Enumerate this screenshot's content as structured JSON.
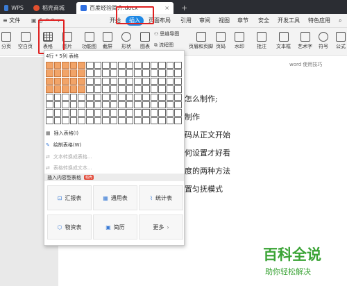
{
  "tabs": {
    "wps": "WPS",
    "store": "稻壳商城",
    "doc": "百度经验简介.docx",
    "add": "+"
  },
  "menubar": {
    "file": "≡ 文件",
    "items": [
      "开始",
      "插入",
      "页面布局",
      "引用",
      "审阅",
      "视图",
      "章节",
      "安全",
      "开发工具",
      "特色应用"
    ],
    "active": "插入"
  },
  "ribbon": {
    "left": [
      "分页",
      "空白页"
    ],
    "table": "表格",
    "picture": "图片",
    "shapes": [
      "功能图",
      "截屏",
      "形状",
      "图表"
    ],
    "mind": [
      "思维导图",
      "流程图"
    ],
    "right": [
      "页眉和页脚",
      "页码",
      "水印",
      "批注",
      "文本框",
      "艺术字",
      "符号",
      "公式"
    ]
  },
  "dropdown": {
    "grid_label": "4行 * 5列 表格",
    "rows": 8,
    "cols": 17,
    "sel_rows": 4,
    "sel_cols": 5,
    "menu": [
      "插入表格(I)",
      "绘制表格(W)",
      "文本转换成表格...",
      "表格转换成文本..."
    ],
    "section": "插入内容型表格",
    "badge": "稻壳",
    "cards": [
      "汇报表",
      "通用表",
      "统计表",
      "物资表",
      "简历",
      "更多"
    ]
  },
  "document": {
    "header": "word 使用技巧",
    "lines": [
      "怎么制作;",
      "制作",
      "码从正文开始",
      "何设置才好看",
      "度的两种方法",
      "置匀抚模式"
    ]
  },
  "watermark": {
    "title": "百科全说",
    "subtitle": "助你轻松解决"
  },
  "colors": {
    "accent": "#1e88e5",
    "highlight": "#e02020",
    "grid_sel": "#f2a468",
    "watermark": "#3aa335"
  }
}
